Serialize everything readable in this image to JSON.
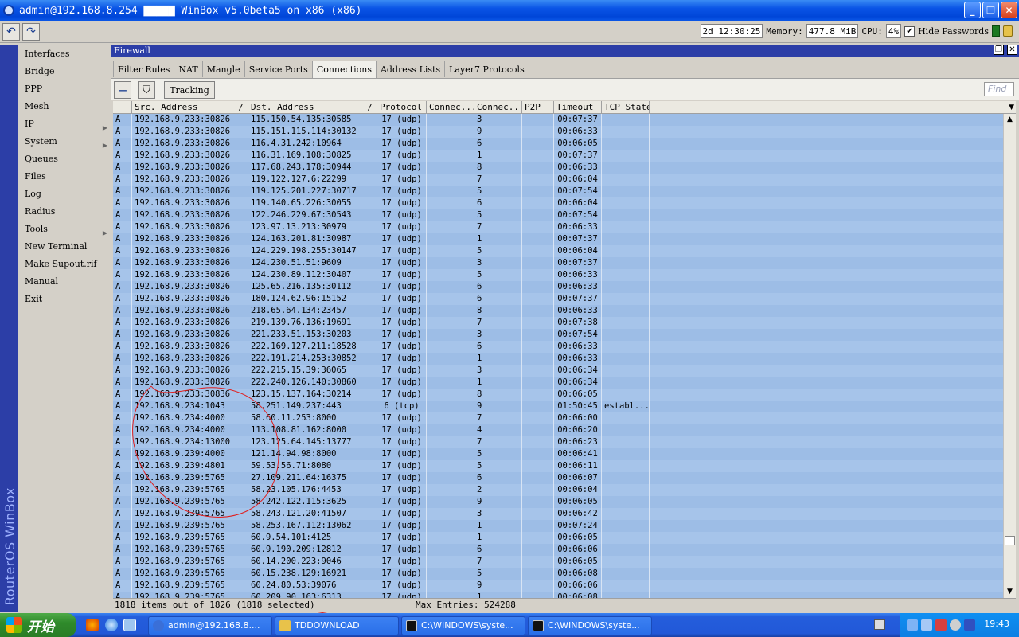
{
  "window": {
    "title": "admin@192.168.8.254 ▇▇▇▇▇ WinBox v5.0beta5 on x86 (x86)",
    "minimize": "_",
    "maximize": "❐",
    "close": "✕"
  },
  "toolbar": {
    "undo_icon": "↶",
    "redo_icon": "↷",
    "uptime": "2d 12:30:25",
    "memory_label": "Memory:",
    "memory_value": "477.8 MiB",
    "cpu_label": "CPU:",
    "cpu_value": "4%",
    "hide_passwords_checked": "✔",
    "hide_passwords_label": "Hide Passwords"
  },
  "sidebar": {
    "brand": "RouterOS WinBox",
    "items": [
      {
        "label": "Interfaces",
        "arrow": ""
      },
      {
        "label": "Bridge",
        "arrow": ""
      },
      {
        "label": "PPP",
        "arrow": ""
      },
      {
        "label": "Mesh",
        "arrow": ""
      },
      {
        "label": "IP",
        "arrow": "▶"
      },
      {
        "label": "System",
        "arrow": "▶"
      },
      {
        "label": "Queues",
        "arrow": ""
      },
      {
        "label": "Files",
        "arrow": ""
      },
      {
        "label": "Log",
        "arrow": ""
      },
      {
        "label": "Radius",
        "arrow": ""
      },
      {
        "label": "Tools",
        "arrow": "▶"
      },
      {
        "label": "New Terminal",
        "arrow": ""
      },
      {
        "label": "Make Supout.rif",
        "arrow": ""
      },
      {
        "label": "Manual",
        "arrow": ""
      },
      {
        "label": "Exit",
        "arrow": ""
      }
    ]
  },
  "firewall": {
    "title": "Firewall",
    "restore_icon": "❐",
    "close_icon": "✕",
    "tabs": [
      "Filter Rules",
      "NAT",
      "Mangle",
      "Service Ports",
      "Connections",
      "Address Lists",
      "Layer7 Protocols"
    ],
    "active_tab": 4,
    "remove_icon": "—",
    "filter_icon": "⛉",
    "tracking_label": "Tracking",
    "find_placeholder": "Find"
  },
  "table": {
    "columns": [
      "",
      "Src. Address",
      "Dst. Address",
      "Protocol",
      "Connec...",
      "Connec...",
      "P2P",
      "Timeout",
      "TCP State"
    ],
    "sort_mark": "/",
    "rows": [
      [
        "A",
        "192.168.9.233:30826",
        "115.150.54.135:30585",
        "17 (udp)",
        "",
        "3",
        "",
        "00:07:37",
        ""
      ],
      [
        "A",
        "192.168.9.233:30826",
        "115.151.115.114:30132",
        "17 (udp)",
        "",
        "9",
        "",
        "00:06:33",
        ""
      ],
      [
        "A",
        "192.168.9.233:30826",
        "116.4.31.242:10964",
        "17 (udp)",
        "",
        "6",
        "",
        "00:06:05",
        ""
      ],
      [
        "A",
        "192.168.9.233:30826",
        "116.31.169.108:30825",
        "17 (udp)",
        "",
        "1",
        "",
        "00:07:37",
        ""
      ],
      [
        "A",
        "192.168.9.233:30826",
        "117.68.243.178:30944",
        "17 (udp)",
        "",
        "8",
        "",
        "00:06:33",
        ""
      ],
      [
        "A",
        "192.168.9.233:30826",
        "119.122.127.6:22299",
        "17 (udp)",
        "",
        "7",
        "",
        "00:06:04",
        ""
      ],
      [
        "A",
        "192.168.9.233:30826",
        "119.125.201.227:30717",
        "17 (udp)",
        "",
        "5",
        "",
        "00:07:54",
        ""
      ],
      [
        "A",
        "192.168.9.233:30826",
        "119.140.65.226:30055",
        "17 (udp)",
        "",
        "6",
        "",
        "00:06:04",
        ""
      ],
      [
        "A",
        "192.168.9.233:30826",
        "122.246.229.67:30543",
        "17 (udp)",
        "",
        "5",
        "",
        "00:07:54",
        ""
      ],
      [
        "A",
        "192.168.9.233:30826",
        "123.97.13.213:30979",
        "17 (udp)",
        "",
        "7",
        "",
        "00:06:33",
        ""
      ],
      [
        "A",
        "192.168.9.233:30826",
        "124.163.201.81:30987",
        "17 (udp)",
        "",
        "1",
        "",
        "00:07:37",
        ""
      ],
      [
        "A",
        "192.168.9.233:30826",
        "124.229.198.255:30147",
        "17 (udp)",
        "",
        "5",
        "",
        "00:06:04",
        ""
      ],
      [
        "A",
        "192.168.9.233:30826",
        "124.230.51.51:9609",
        "17 (udp)",
        "",
        "3",
        "",
        "00:07:37",
        ""
      ],
      [
        "A",
        "192.168.9.233:30826",
        "124.230.89.112:30407",
        "17 (udp)",
        "",
        "5",
        "",
        "00:06:33",
        ""
      ],
      [
        "A",
        "192.168.9.233:30826",
        "125.65.216.135:30112",
        "17 (udp)",
        "",
        "6",
        "",
        "00:06:33",
        ""
      ],
      [
        "A",
        "192.168.9.233:30826",
        "180.124.62.96:15152",
        "17 (udp)",
        "",
        "6",
        "",
        "00:07:37",
        ""
      ],
      [
        "A",
        "192.168.9.233:30826",
        "218.65.64.134:23457",
        "17 (udp)",
        "",
        "8",
        "",
        "00:06:33",
        ""
      ],
      [
        "A",
        "192.168.9.233:30826",
        "219.139.76.136:19691",
        "17 (udp)",
        "",
        "7",
        "",
        "00:07:38",
        ""
      ],
      [
        "A",
        "192.168.9.233:30826",
        "221.233.51.153:30203",
        "17 (udp)",
        "",
        "3",
        "",
        "00:07:54",
        ""
      ],
      [
        "A",
        "192.168.9.233:30826",
        "222.169.127.211:18528",
        "17 (udp)",
        "",
        "6",
        "",
        "00:06:33",
        ""
      ],
      [
        "A",
        "192.168.9.233:30826",
        "222.191.214.253:30852",
        "17 (udp)",
        "",
        "1",
        "",
        "00:06:33",
        ""
      ],
      [
        "A",
        "192.168.9.233:30826",
        "222.215.15.39:36065",
        "17 (udp)",
        "",
        "3",
        "",
        "00:06:34",
        ""
      ],
      [
        "A",
        "192.168.9.233:30826",
        "222.240.126.140:30860",
        "17 (udp)",
        "",
        "1",
        "",
        "00:06:34",
        ""
      ],
      [
        "A",
        "192.168.9.233:30836",
        "123.15.137.164:30214",
        "17 (udp)",
        "",
        "8",
        "",
        "00:06:05",
        ""
      ],
      [
        "A",
        "192.168.9.234:1043",
        "58.251.149.237:443",
        "6 (tcp)",
        "",
        "9",
        "",
        "01:50:45",
        "establ..."
      ],
      [
        "A",
        "192.168.9.234:4000",
        "58.60.11.253:8000",
        "17 (udp)",
        "",
        "7",
        "",
        "00:06:00",
        ""
      ],
      [
        "A",
        "192.168.9.234:4000",
        "113.108.81.162:8000",
        "17 (udp)",
        "",
        "4",
        "",
        "00:06:20",
        ""
      ],
      [
        "A",
        "192.168.9.234:13000",
        "123.125.64.145:13777",
        "17 (udp)",
        "",
        "7",
        "",
        "00:06:23",
        ""
      ],
      [
        "A",
        "192.168.9.239:4000",
        "121.14.94.98:8000",
        "17 (udp)",
        "",
        "5",
        "",
        "00:06:41",
        ""
      ],
      [
        "A",
        "192.168.9.239:4801",
        "59.53.56.71:8080",
        "17 (udp)",
        "",
        "5",
        "",
        "00:06:11",
        ""
      ],
      [
        "A",
        "192.168.9.239:5765",
        "27.109.211.64:16375",
        "17 (udp)",
        "",
        "6",
        "",
        "00:06:07",
        ""
      ],
      [
        "A",
        "192.168.9.239:5765",
        "58.23.105.176:4453",
        "17 (udp)",
        "",
        "2",
        "",
        "00:06:04",
        ""
      ],
      [
        "A",
        "192.168.9.239:5765",
        "58.242.122.115:3625",
        "17 (udp)",
        "",
        "9",
        "",
        "00:06:05",
        ""
      ],
      [
        "A",
        "192.168.9.239:5765",
        "58.243.121.20:41507",
        "17 (udp)",
        "",
        "3",
        "",
        "00:06:42",
        ""
      ],
      [
        "A",
        "192.168.9.239:5765",
        "58.253.167.112:13062",
        "17 (udp)",
        "",
        "1",
        "",
        "00:07:24",
        ""
      ],
      [
        "A",
        "192.168.9.239:5765",
        "60.9.54.101:4125",
        "17 (udp)",
        "",
        "1",
        "",
        "00:06:05",
        ""
      ],
      [
        "A",
        "192.168.9.239:5765",
        "60.9.190.209:12812",
        "17 (udp)",
        "",
        "6",
        "",
        "00:06:06",
        ""
      ],
      [
        "A",
        "192.168.9.239:5765",
        "60.14.200.223:9046",
        "17 (udp)",
        "",
        "7",
        "",
        "00:06:05",
        ""
      ],
      [
        "A",
        "192.168.9.239:5765",
        "60.15.238.129:16921",
        "17 (udp)",
        "",
        "5",
        "",
        "00:06:08",
        ""
      ],
      [
        "A",
        "192.168.9.239:5765",
        "60.24.80.53:39076",
        "17 (udp)",
        "",
        "9",
        "",
        "00:06:06",
        ""
      ],
      [
        "A",
        "192.168.9.239:5765",
        "60.209.90.163:6313",
        "17 (udp)",
        "",
        "1",
        "",
        "00:06:08",
        ""
      ]
    ],
    "scroll_up": "▲",
    "scroll_down": "▼",
    "header_menu": "▼"
  },
  "statusbar": {
    "items_text": "1818 items out of 1826 (1818 selected)",
    "max_entries": "Max Entries: 524288"
  },
  "taskbar": {
    "start_label": "开始",
    "tasks": [
      {
        "label": "admin@192.168.8....",
        "color": "#3a6fd8"
      },
      {
        "label": "TDDOWNLOAD",
        "color": "#e8c24a"
      },
      {
        "label": "C:\\WINDOWS\\syste...",
        "color": "#111111"
      },
      {
        "label": "C:\\WINDOWS\\syste...",
        "color": "#111111"
      }
    ],
    "clock": "19:43"
  }
}
